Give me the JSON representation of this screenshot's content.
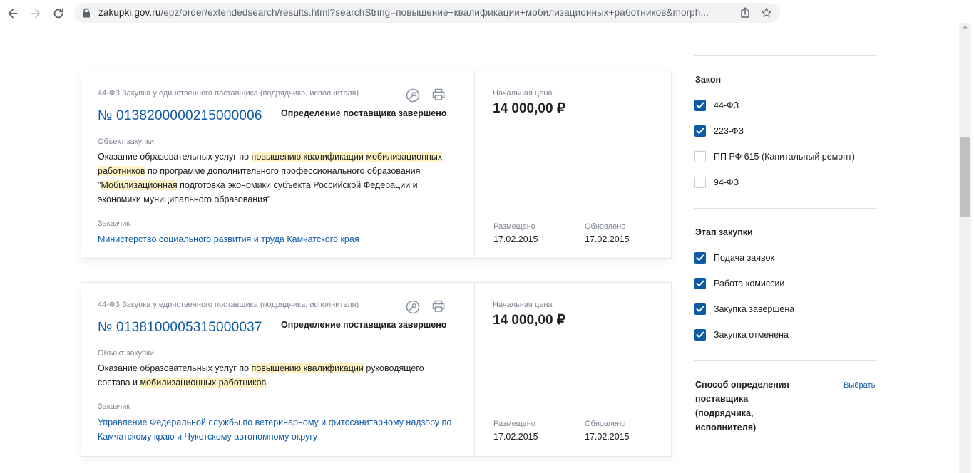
{
  "browser": {
    "url_host": "zakupki.gov.ru",
    "url_rest": "/epz/order/extendedsearch/results.html?searchString=повышение+квалификации+мобилизационных+работников&morph..."
  },
  "cards": [
    {
      "type_label": "44-ФЗ Закупка у единственного поставщика (подрядчика, исполнителя)",
      "reg_number": "№ 0138200000215000006",
      "status": "Определение поставщика завершено",
      "object_label": "Объект закупки",
      "object_parts": [
        {
          "t": "Оказание образовательных услуг по ",
          "h": false
        },
        {
          "t": "повышению квалификации",
          "h": true
        },
        {
          "t": " ",
          "h": false
        },
        {
          "t": "мобилизационных работников",
          "h": true
        },
        {
          "t": " по программе дополнительного профессионального образования \"",
          "h": false
        },
        {
          "t": "Мобилизационная",
          "h": true
        },
        {
          "t": " подготовка экономики субъекта Российской Федерации и экономики муниципального образования\"",
          "h": false
        }
      ],
      "customer_label": "Заказчик",
      "customer_name": "Министерство социального развития и труда Камчатского края",
      "price_label": "Начальная цена",
      "price": "14 000,00 ₽",
      "placed_label": "Размещено",
      "placed_date": "17.02.2015",
      "updated_label": "Обновлено",
      "updated_date": "17.02.2015"
    },
    {
      "type_label": "44-ФЗ Закупка у единственного поставщика (подрядчика, исполнителя)",
      "reg_number": "№ 0138100005315000037",
      "status": "Определение поставщика завершено",
      "object_label": "Объект закупки",
      "object_parts": [
        {
          "t": "Оказание образовательных услуг по ",
          "h": false
        },
        {
          "t": "повышению квалификации",
          "h": true
        },
        {
          "t": " руководящего состава и ",
          "h": false
        },
        {
          "t": "мобилизационных работников",
          "h": true
        }
      ],
      "customer_label": "Заказчик",
      "customer_name": "Управление Федеральной службы по ветеринарному и фитосанитарному надзору по Камчатскому краю и Чукотскому автономному округу",
      "price_label": "Начальная цена",
      "price": "14 000,00 ₽",
      "placed_label": "Размещено",
      "placed_date": "17.02.2015",
      "updated_label": "Обновлено",
      "updated_date": "17.02.2015"
    }
  ],
  "filters": {
    "law": {
      "title": "Закон",
      "items": [
        {
          "label": "44-ФЗ",
          "checked": true
        },
        {
          "label": "223-ФЗ",
          "checked": true
        },
        {
          "label": "ПП РФ 615 (Капитальный ремонт)",
          "checked": false
        },
        {
          "label": "94-ФЗ",
          "checked": false
        }
      ]
    },
    "stage": {
      "title": "Этап закупки",
      "items": [
        {
          "label": "Подача заявок",
          "checked": true
        },
        {
          "label": "Работа комиссии",
          "checked": true
        },
        {
          "label": "Закупка завершена",
          "checked": true
        },
        {
          "label": "Закупка отменена",
          "checked": true
        }
      ]
    },
    "method": {
      "title": "Способ определения поставщика (подрядчика, исполнителя)",
      "choose_label": "Выбрать"
    }
  },
  "colors": {
    "link": "#0d5aa7",
    "highlight": "#fdf3c4",
    "checkbox": "#0d5aa7"
  }
}
